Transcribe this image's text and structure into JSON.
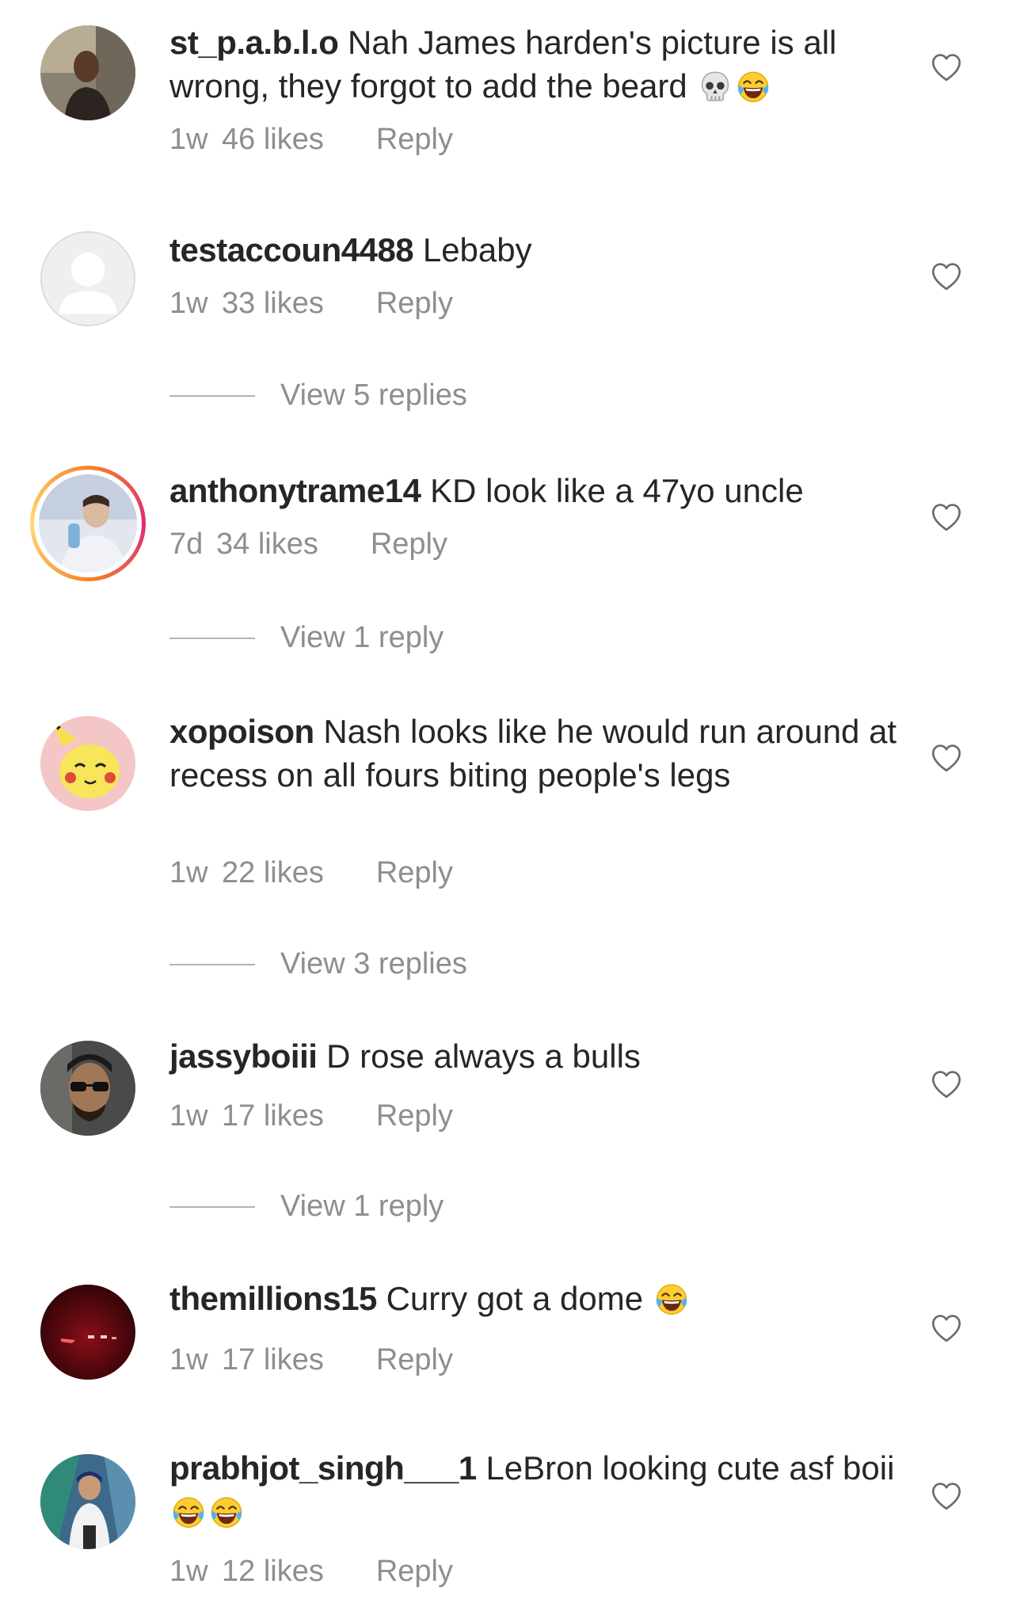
{
  "comments": [
    {
      "username": "st_p.a.b.l.o",
      "text": "Nah James harden's picture is all wrong, they forgot to add the beard",
      "emojis": [
        "skull",
        "tears-of-joy"
      ],
      "time": "1w",
      "likes": "46 likes",
      "reply": "Reply"
    },
    {
      "username": "testaccoun4488",
      "text": "Lebaby",
      "time": "1w",
      "likes": "33 likes",
      "reply": "Reply",
      "view_replies": "View 5 replies"
    },
    {
      "username": "anthonytrame14",
      "text": "KD look like a 47yo uncle",
      "time": "7d",
      "likes": "34 likes",
      "reply": "Reply",
      "view_replies": "View 1 reply"
    },
    {
      "username": "xopoison",
      "text": "Nash looks like he would run around at recess on all fours biting people's legs",
      "time": "1w",
      "likes": "22 likes",
      "reply": "Reply",
      "view_replies": "View 3 replies"
    },
    {
      "username": "jassyboiii",
      "text": "D rose always a bulls",
      "time": "1w",
      "likes": "17 likes",
      "reply": "Reply",
      "view_replies": "View 1 reply"
    },
    {
      "username": "themillions15",
      "text": "Curry got a dome",
      "emojis": [
        "tears-of-joy"
      ],
      "time": "1w",
      "likes": "17 likes",
      "reply": "Reply"
    },
    {
      "username": "prabhjot_singh___1",
      "text": "LeBron looking cute asf boii",
      "emojis": [
        "tears-of-joy",
        "tears-of-joy"
      ],
      "time": "1w",
      "likes": "12 likes",
      "reply": "Reply"
    }
  ],
  "icons": {
    "like": "heart-outline-icon",
    "skull": "skull-emoji",
    "laugh": "tears-of-joy-emoji"
  },
  "colors": {
    "text": "#262626",
    "secondary": "#8e8e8e",
    "divider": "#b3b3b3"
  }
}
